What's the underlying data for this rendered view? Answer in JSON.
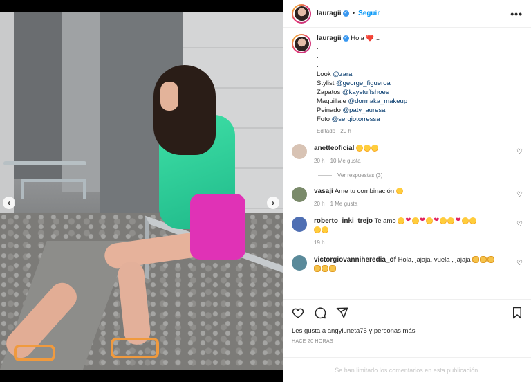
{
  "post": {
    "username": "lauragii",
    "follow_label": "Seguir",
    "more_label": "•••",
    "nav_prev": "‹",
    "nav_next": "›"
  },
  "caption": {
    "username": "lauragii",
    "first": "Hola ❤️...",
    "dots": [
      ".",
      ".",
      "."
    ],
    "lines": [
      {
        "prefix": "Look ",
        "mention": "@zara"
      },
      {
        "prefix": "Stylist ",
        "mention": "@george_figueroa"
      },
      {
        "prefix": "Zapatos ",
        "mention": "@kaystuffshoes"
      },
      {
        "prefix": "Maquillaje ",
        "mention": "@dormaka_makeup"
      },
      {
        "prefix": "Peinado ",
        "mention": "@paty_auresa"
      },
      {
        "prefix": "Foto ",
        "mention": "@sergiotorressa"
      }
    ],
    "meta": "Editado · 20 h"
  },
  "comments": [
    {
      "username": "anetteoficial",
      "text": "",
      "emojis": [
        "😍",
        "😍",
        "😍"
      ],
      "time": "20 h",
      "likes": "10 Me gusta",
      "replies": "Ver respuestas (3)",
      "avatar_color": "#d8c3b4"
    },
    {
      "username": "vasaji",
      "text": "Ame tu combinación",
      "emojis": [
        "😍"
      ],
      "time": "20 h",
      "likes": "1 Me gusta",
      "replies": "",
      "avatar_color": "#7a8a6a"
    },
    {
      "username": "roberto_inki_trejo",
      "text": "Te amo",
      "emojis": [
        "😍",
        "❤️",
        "😍",
        "❤️",
        "😍",
        "❤️",
        "😍",
        "😍",
        "❤️",
        "😍",
        "😍",
        "😍",
        "😍"
      ],
      "time": "19 h",
      "likes": "",
      "replies": "",
      "avatar_color": "#4f6fb3"
    },
    {
      "username": "victorgiovanniheredia_of",
      "text": "Hola, jajaja, vuela , jajaja",
      "emojis": [
        "👏",
        "👏",
        "👏",
        "👏",
        "👏",
        "👏"
      ],
      "time": "",
      "likes": "",
      "replies": "",
      "avatar_color": "#5a8a9a"
    }
  ],
  "footer": {
    "likes_text": "Les gusta a angyluneta75 y personas más",
    "date": "HACE 20 HORAS",
    "limited": "Se han limitado los comentarios en esta publicación."
  },
  "colors": {
    "accent": "#0095f6",
    "verified": "#3897f0",
    "mention": "#00376b"
  }
}
